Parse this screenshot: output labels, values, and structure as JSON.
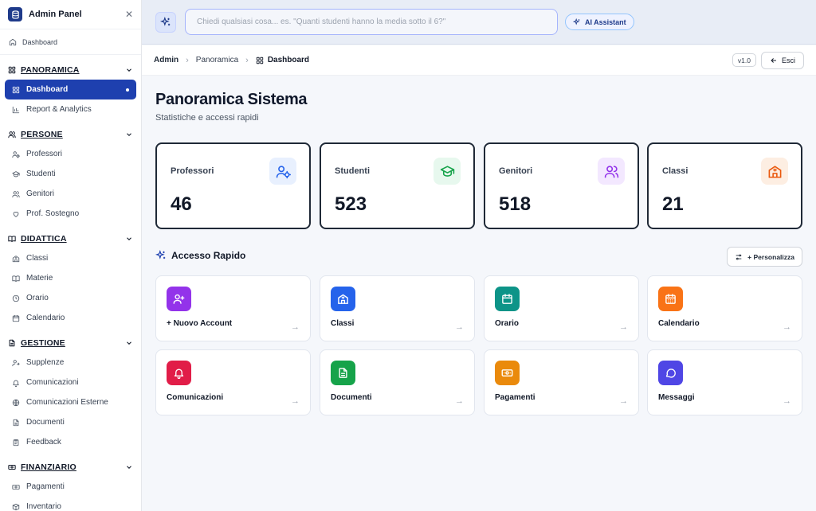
{
  "sidebar": {
    "title": "Admin Panel",
    "top_link": "Dashboard",
    "sections": [
      {
        "label": "PANORAMICA",
        "items": [
          {
            "label": "Dashboard",
            "icon": "grid-icon",
            "active": true
          },
          {
            "label": "Report & Analytics",
            "icon": "chart-icon"
          }
        ]
      },
      {
        "label": "PERSONE",
        "items": [
          {
            "label": "Professori",
            "icon": "user-cog-icon"
          },
          {
            "label": "Studenti",
            "icon": "graduation-cap-icon"
          },
          {
            "label": "Genitori",
            "icon": "users-icon"
          },
          {
            "label": "Prof. Sostegno",
            "icon": "heart-hand-icon"
          }
        ]
      },
      {
        "label": "DIDATTICA",
        "items": [
          {
            "label": "Classi",
            "icon": "school-icon"
          },
          {
            "label": "Materie",
            "icon": "book-icon"
          },
          {
            "label": "Orario",
            "icon": "clock-icon"
          },
          {
            "label": "Calendario",
            "icon": "calendar-icon"
          }
        ]
      },
      {
        "label": "GESTIONE",
        "items": [
          {
            "label": "Supplenze",
            "icon": "user-swap-icon"
          },
          {
            "label": "Comunicazioni",
            "icon": "bell-icon"
          },
          {
            "label": "Comunicazioni Esterne",
            "icon": "globe-icon"
          },
          {
            "label": "Documenti",
            "icon": "file-icon"
          },
          {
            "label": "Feedback",
            "icon": "clipboard-icon"
          }
        ]
      },
      {
        "label": "FINANZIARIO",
        "items": [
          {
            "label": "Pagamenti",
            "icon": "banknote-icon"
          },
          {
            "label": "Inventario",
            "icon": "box-icon"
          }
        ]
      }
    ]
  },
  "topbar": {
    "search_placeholder": "Chiedi qualsiasi cosa... es. \"Quanti studenti hanno la media sotto il 6?\"",
    "ai_button": "AI Assistant"
  },
  "breadcrumb": {
    "items": [
      "Admin",
      "Panoramica"
    ],
    "current": "Dashboard",
    "version": "v1.0",
    "exit": "Esci"
  },
  "main": {
    "title": "Panoramica Sistema",
    "subtitle": "Statistiche e accessi rapidi",
    "stats": [
      {
        "label": "Professori",
        "value": "46",
        "icon": "user-cog-icon",
        "color": "#2563eb",
        "bg": "#e8f0fe"
      },
      {
        "label": "Studenti",
        "value": "523",
        "icon": "graduation-cap-icon",
        "color": "#16a34a",
        "bg": "#e7f8ee"
      },
      {
        "label": "Genitori",
        "value": "518",
        "icon": "users-icon",
        "color": "#9333ea",
        "bg": "#f3e8ff"
      },
      {
        "label": "Classi",
        "value": "21",
        "icon": "school-icon",
        "color": "#ea580c",
        "bg": "#fdeee2"
      }
    ],
    "quick_title": "Accesso Rapido",
    "customize": "+ Personalizza",
    "quick": [
      {
        "label": "+ Nuovo Account",
        "icon": "user-plus-icon",
        "color": "#9333ea"
      },
      {
        "label": "Classi",
        "icon": "school-icon",
        "color": "#2563eb"
      },
      {
        "label": "Orario",
        "icon": "calendar-icon",
        "color": "#0d9488"
      },
      {
        "label": "Calendario",
        "icon": "calendar-grid-icon",
        "color": "#f97316"
      },
      {
        "label": "Comunicazioni",
        "icon": "bell-icon",
        "color": "#e11d48"
      },
      {
        "label": "Documenti",
        "icon": "file-icon",
        "color": "#16a34a"
      },
      {
        "label": "Pagamenti",
        "icon": "banknote-icon",
        "color": "#ea8a0c"
      },
      {
        "label": "Messaggi",
        "icon": "message-icon",
        "color": "#4f46e5"
      }
    ]
  }
}
